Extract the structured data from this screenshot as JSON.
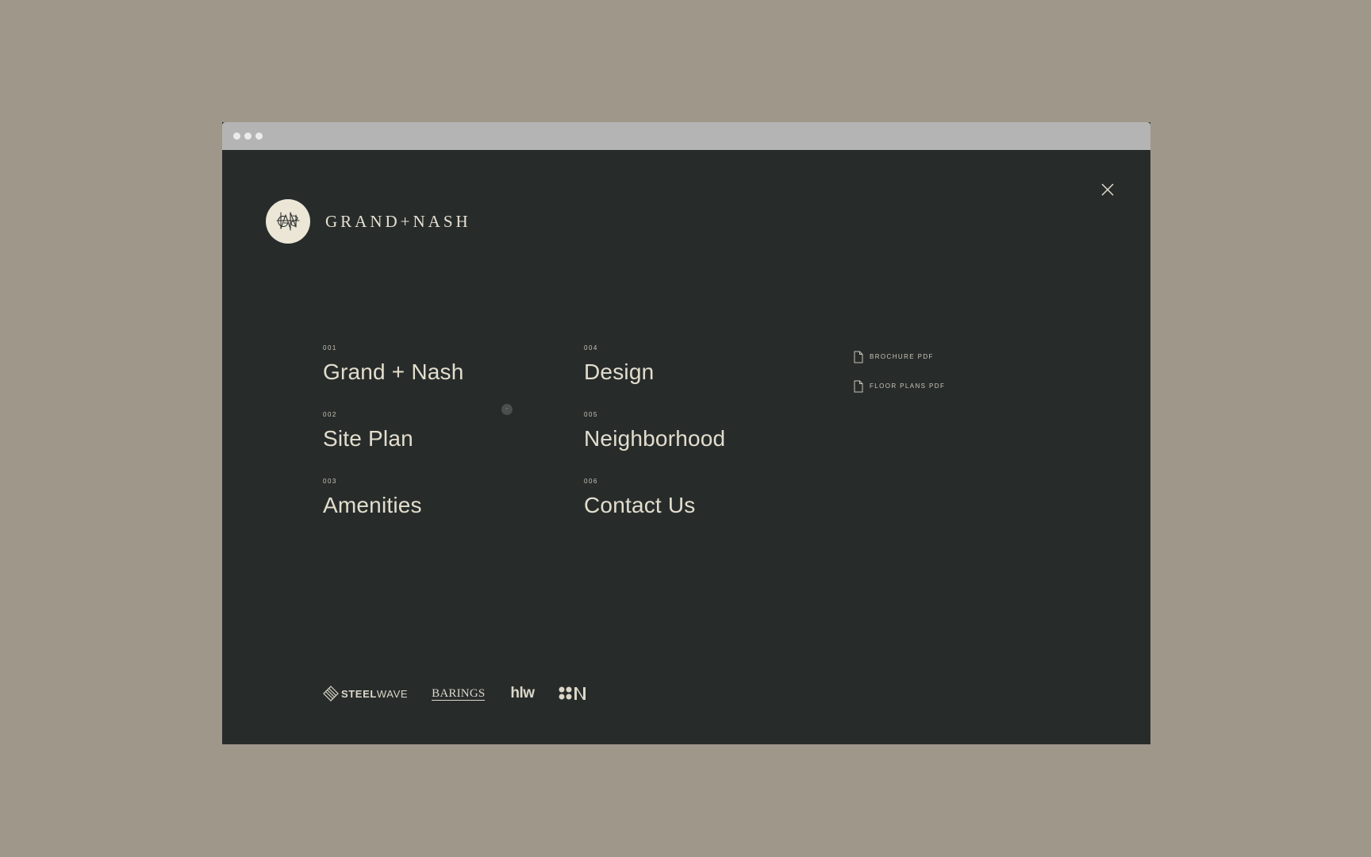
{
  "brand": {
    "name": "GRAND+NASH",
    "logo_icon": "monogram-logo-icon"
  },
  "close": {
    "icon": "close-icon"
  },
  "nav": {
    "column1": [
      {
        "number": "001",
        "label": "Grand + Nash"
      },
      {
        "number": "002",
        "label": "Site Plan"
      },
      {
        "number": "003",
        "label": "Amenities"
      }
    ],
    "column2": [
      {
        "number": "004",
        "label": "Design"
      },
      {
        "number": "005",
        "label": "Neighborhood"
      },
      {
        "number": "006",
        "label": "Contact Us"
      }
    ]
  },
  "downloads": [
    {
      "label": "BROCHURE PDF",
      "icon": "document-icon"
    },
    {
      "label": "FLOOR PLANS PDF",
      "icon": "document-icon"
    }
  ],
  "cursor": {
    "glyph": "-"
  },
  "partners": {
    "steelwave_bold": "STEEL",
    "steelwave_light": "WAVE",
    "barings": "BARINGS",
    "hlw": "hlw",
    "last_logo_icon": "n-partner-logo-icon"
  },
  "colors": {
    "page_background": "#a0978b",
    "panel_background": "#272c2b",
    "text_primary": "#e3ddcd",
    "logo_circle": "#ebe6d6"
  }
}
